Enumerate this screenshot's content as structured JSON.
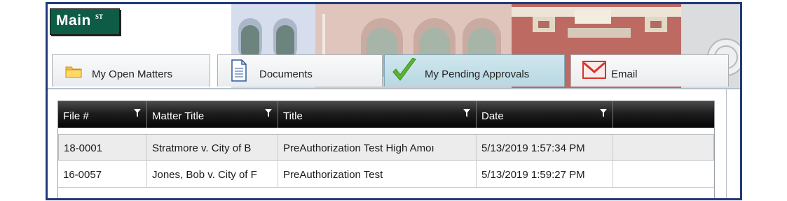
{
  "app": {
    "logo_main": "Main",
    "logo_st": "ST"
  },
  "tabs": [
    {
      "label": "My Open Matters",
      "icon": "folder-icon",
      "active": false
    },
    {
      "label": "Documents",
      "icon": "document-icon",
      "active": false
    },
    {
      "label": "My Pending Approvals",
      "icon": "checkmark-icon",
      "active": true
    },
    {
      "label": "Email",
      "icon": "email-icon",
      "active": false
    }
  ],
  "grid": {
    "columns": [
      {
        "label": "File #",
        "filter_icon": "filter-icon"
      },
      {
        "label": "Matter Title",
        "filter_icon": "filter-icon"
      },
      {
        "label": "Title",
        "filter_icon": "filter-icon"
      },
      {
        "label": "Date",
        "filter_icon": "filter-icon"
      }
    ],
    "rows": [
      {
        "file": "18-0001",
        "matter_title": "Stratmore v. City of B",
        "title": "PreAuthorization Test High Amoı",
        "date": "5/13/2019 1:57:34 PM",
        "selected": true
      },
      {
        "file": "16-0057",
        "matter_title": "Jones, Bob v. City of F",
        "title": "PreAuthorization Test",
        "date": "5/13/2019 1:59:27 PM",
        "selected": false
      }
    ]
  },
  "colors": {
    "frame_border": "#1f3a7a",
    "logo_bg": "#0e5b46",
    "header_bg": "#1e1e1e",
    "active_tab": "#b9d8e2"
  }
}
